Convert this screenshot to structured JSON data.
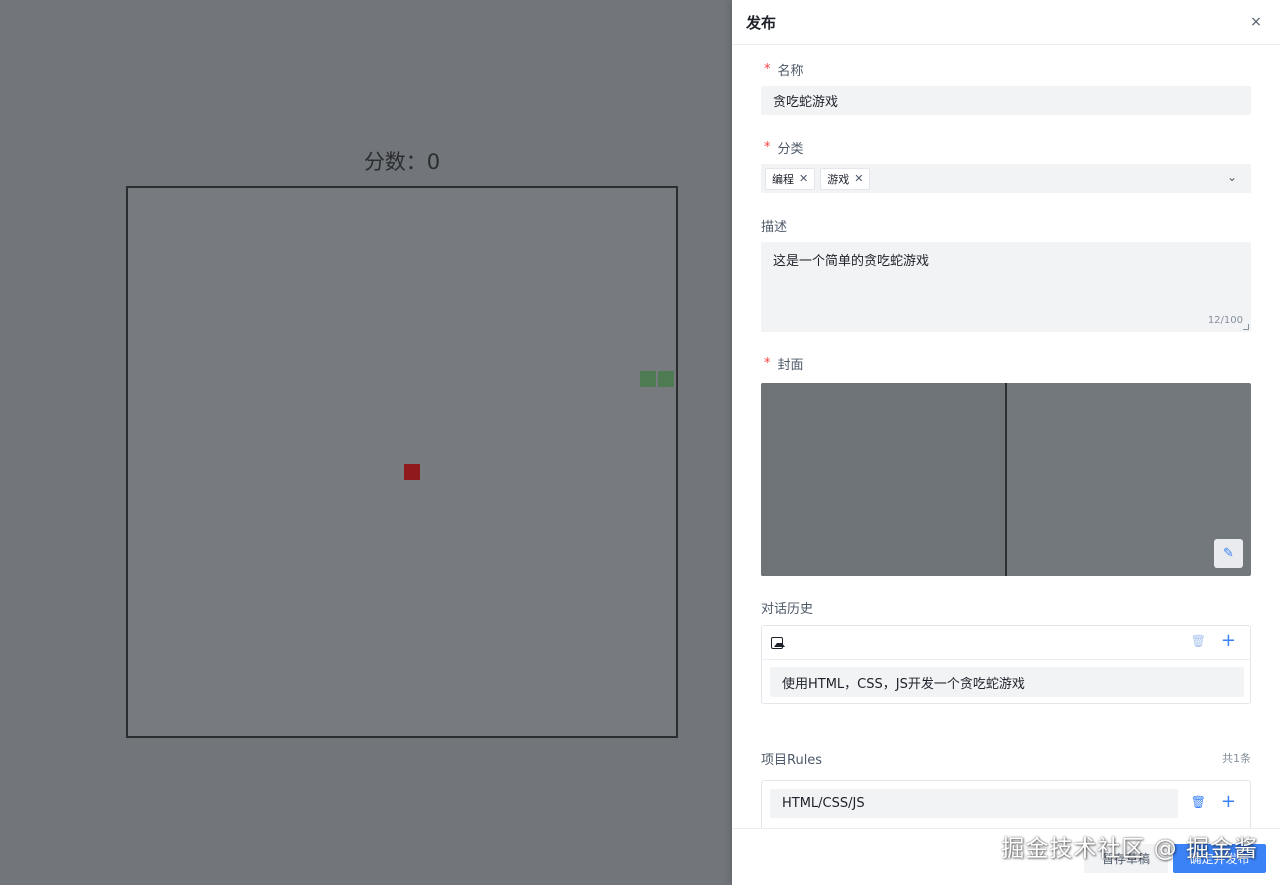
{
  "game": {
    "score_text": "分数：0"
  },
  "drawer": {
    "title": "发布",
    "close_glyph": "×",
    "name": {
      "label": "名称",
      "value": "贪吃蛇游戏"
    },
    "category": {
      "label": "分类",
      "tags": [
        "编程",
        "游戏"
      ]
    },
    "description": {
      "label": "描述",
      "value": "这是一个简单的贪吃蛇游戏",
      "count": "12/100"
    },
    "cover": {
      "label": "封面"
    },
    "history": {
      "label": "对话历史",
      "message": "使用HTML，CSS，JS开发一个贪吃蛇游戏"
    },
    "rules": {
      "label": "项目Rules",
      "count": "共1条",
      "items": [
        "HTML/CSS/JS"
      ]
    },
    "footer": {
      "draft_label": "暂存草稿",
      "publish_label": "确定并发布"
    }
  },
  "watermark": "掘金技术社区 @ 掘金酱",
  "colors": {
    "accent": "#3b82f6",
    "required": "#f53f3f",
    "food": "#8f1a1d",
    "snake": "#4f7b52"
  }
}
